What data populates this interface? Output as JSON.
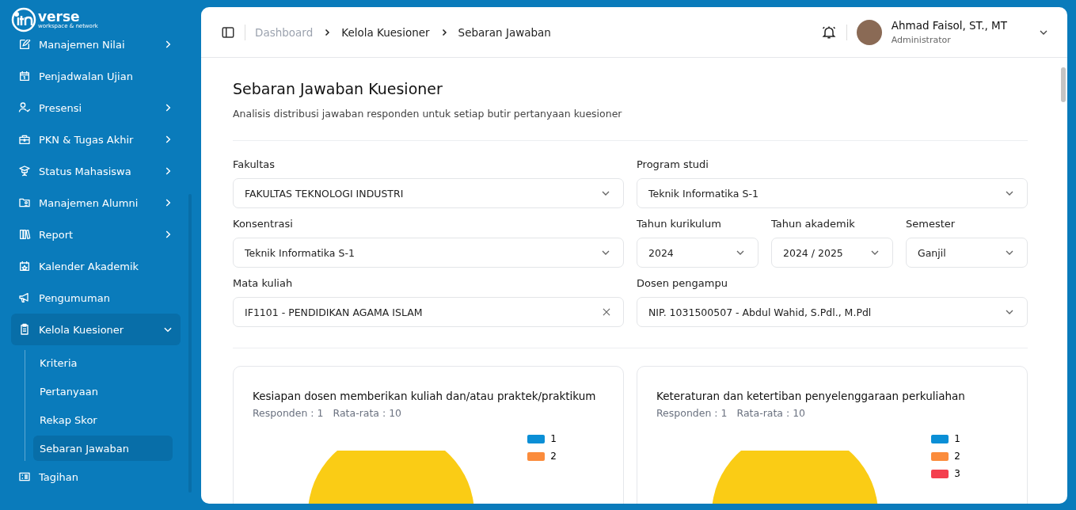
{
  "sidebar": {
    "logo": "verse",
    "logo_tagline": "workspace & network",
    "items": [
      {
        "label": "Manajemen Nilai",
        "has_submenu": true,
        "expanded": false
      },
      {
        "label": "Penjadwalan Ujian",
        "has_submenu": false,
        "expanded": false
      },
      {
        "label": "Presensi",
        "has_submenu": true,
        "expanded": false
      },
      {
        "label": "PKN & Tugas Akhir",
        "has_submenu": true,
        "expanded": false
      },
      {
        "label": "Status Mahasiswa",
        "has_submenu": true,
        "expanded": false
      },
      {
        "label": "Manajemen Alumni",
        "has_submenu": true,
        "expanded": false
      },
      {
        "label": "Report",
        "has_submenu": true,
        "expanded": false
      },
      {
        "label": "Kalender Akademik",
        "has_submenu": false,
        "expanded": false
      },
      {
        "label": "Pengumuman",
        "has_submenu": false,
        "expanded": false
      },
      {
        "label": "Kelola Kuesioner",
        "has_submenu": true,
        "expanded": true,
        "children": [
          {
            "label": "Kriteria",
            "selected": false
          },
          {
            "label": "Pertanyaan",
            "selected": false
          },
          {
            "label": "Rekap Skor",
            "selected": false
          },
          {
            "label": "Sebaran Jawaban",
            "selected": true
          }
        ]
      },
      {
        "label": "Tagihan",
        "has_submenu": false,
        "expanded": false
      }
    ]
  },
  "breadcrumb": [
    {
      "label": "Dashboard",
      "current": false
    },
    {
      "label": "Kelola Kuesioner",
      "current": true
    },
    {
      "label": "Sebaran Jawaban",
      "current": true
    }
  ],
  "user": {
    "name": "Ahmad Faisol, ST., MT",
    "role": "Administrator"
  },
  "page": {
    "title": "Sebaran Jawaban Kuesioner",
    "subtitle": "Analisis distribusi jawaban responden untuk setiap butir pertanyaan kuesioner"
  },
  "filters": [
    {
      "label": "Fakultas",
      "value": "FAKULTAS TEKNOLOGI INDUSTRI",
      "kind": "select"
    },
    {
      "label": "Program studi",
      "value": "Teknik Informatika S-1",
      "kind": "select"
    },
    {
      "label": "Konsentrasi",
      "value": "Teknik Informatika S-1",
      "kind": "select"
    },
    {
      "label": "Tahun kurikulum",
      "value": "2024",
      "kind": "select"
    },
    {
      "label": "Tahun akademik",
      "value": "2024 / 2025",
      "kind": "select"
    },
    {
      "label": "Semester",
      "value": "Ganjil",
      "kind": "select"
    },
    {
      "label": "Mata kuliah",
      "value": "IF1101 - PENDIDIKAN AGAMA ISLAM",
      "kind": "clearable"
    },
    {
      "label": "Dosen pengampu",
      "value": "NIP. 1031500507 - Abdul Wahid, S.Pdl., M.Pdl",
      "kind": "select"
    }
  ],
  "questions": [
    {
      "title": "Kesiapan dosen memberikan kuliah dan/atau praktek/praktikum",
      "respondents": "Responden : 1",
      "average": "Rata-rata : 10",
      "legend": [
        {
          "label": "1",
          "color": "#0b8fd6"
        },
        {
          "label": "2",
          "color": "#fb8c3c"
        }
      ]
    },
    {
      "title": "Keteraturan dan ketertiban penyelenggaraan perkuliahan",
      "respondents": "Responden : 1",
      "average": "Rata-rata : 10",
      "legend": [
        {
          "label": "1",
          "color": "#0b8fd6"
        },
        {
          "label": "2",
          "color": "#fb8c3c"
        },
        {
          "label": "3",
          "color": "#f43f4e"
        }
      ]
    }
  ]
}
